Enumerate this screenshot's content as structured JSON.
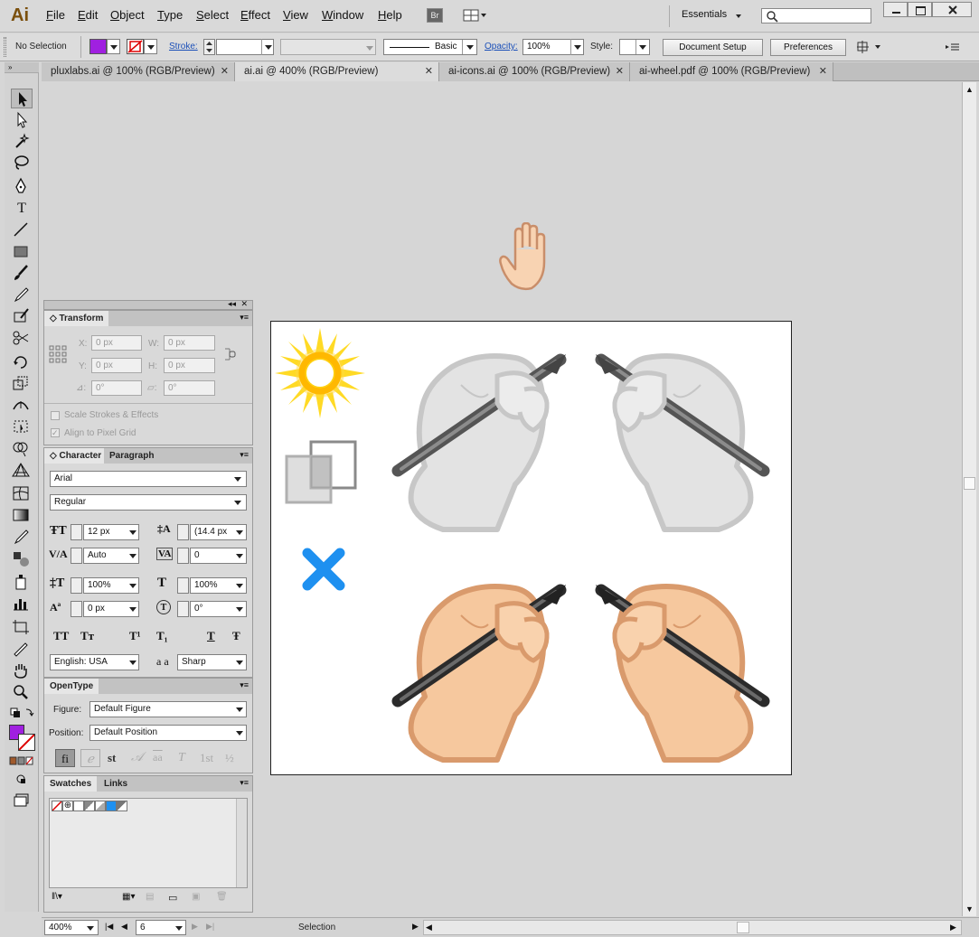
{
  "app": {
    "logo": "Ai"
  },
  "menu": [
    "File",
    "Edit",
    "Object",
    "Type",
    "Select",
    "Effect",
    "View",
    "Window",
    "Help"
  ],
  "menubar_right": {
    "bridge": "Br",
    "workspace": "Essentials",
    "search_placeholder": ""
  },
  "controlbar": {
    "selection": "No Selection",
    "fill_color": "#a020e0",
    "stroke_label": "Stroke:",
    "stroke_value": "",
    "brush": "Basic",
    "opacity_label": "Opacity:",
    "opacity_value": "100%",
    "style_label": "Style:",
    "document_setup": "Document Setup",
    "preferences": "Preferences"
  },
  "tabs": [
    {
      "label": "pluxlabs.ai @ 100% (RGB/Preview)",
      "active": false
    },
    {
      "label": "ai.ai @ 400% (RGB/Preview)",
      "active": true
    },
    {
      "label": "ai-icons.ai @ 100% (RGB/Preview)",
      "active": false
    },
    {
      "label": "ai-wheel.pdf @ 100% (RGB/Preview)",
      "active": false
    }
  ],
  "transform": {
    "tab": "Transform",
    "x_label": "X:",
    "x_value": "0 px",
    "w_label": "W:",
    "w_value": "0 px",
    "y_label": "Y:",
    "y_value": "0 px",
    "h_label": "H:",
    "h_value": "0 px",
    "rotate_value": "0°",
    "shear_value": "0°",
    "scale_strokes": "Scale Strokes & Effects",
    "align_pixel": "Align to Pixel Grid"
  },
  "character": {
    "tab_character": "Character",
    "tab_paragraph": "Paragraph",
    "font": "Arial",
    "style": "Regular",
    "size": "12 px",
    "leading": "(14.4 px",
    "kerning": "Auto",
    "tracking": "0",
    "vscale": "100%",
    "hscale": "100%",
    "baseline": "0 px",
    "rotation": "0°",
    "language": "English: USA",
    "aa_label": "a a",
    "antialias": "Sharp",
    "caps_glyphs": [
      "TT",
      "Tт",
      "T¹",
      "T₁",
      "T",
      "Ŧ"
    ]
  },
  "opentype": {
    "tab": "OpenType",
    "figure_label": "Figure:",
    "figure_value": "Default Figure",
    "position_label": "Position:",
    "position_value": "Default Position",
    "glyphs": [
      "fi",
      "ℯ",
      "st",
      "𝒜",
      "aa",
      "T",
      "1st",
      "½"
    ]
  },
  "swatches": {
    "tab_swatches": "Swatches",
    "tab_links": "Links"
  },
  "status": {
    "zoom": "400%",
    "artboard": "6",
    "mode": "Selection"
  },
  "colors": {
    "fill": "#a020e0",
    "accent_x": "#1e90f0",
    "sun": "#ffd000",
    "skin": "#f3c79e"
  }
}
